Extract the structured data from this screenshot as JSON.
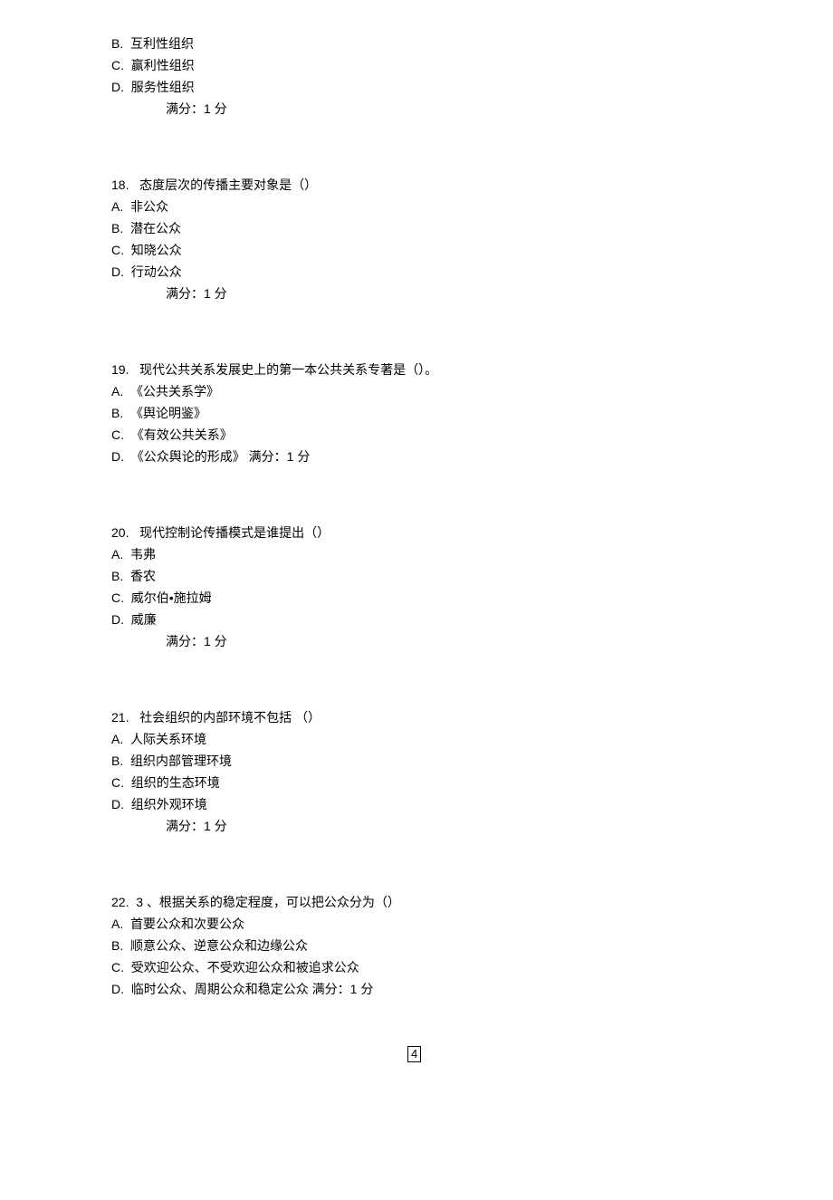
{
  "pageNumber": "4",
  "partial17": {
    "options": [
      {
        "label": "B.",
        "text": "互利性组织"
      },
      {
        "label": "C.",
        "text": "赢利性组织"
      },
      {
        "label": "D.",
        "text": "服务性组织"
      }
    ],
    "score": "满分：1 分"
  },
  "questions": [
    {
      "number": "18.",
      "stem": "态度层次的传播主要对象是（）",
      "options": [
        {
          "label": "A.",
          "text": "非公众"
        },
        {
          "label": "B.",
          "text": "潜在公众"
        },
        {
          "label": "C.",
          "text": "知晓公众"
        },
        {
          "label": "D.",
          "text": "行动公众"
        }
      ],
      "scoreInline": "",
      "score": "满分：1 分"
    },
    {
      "number": "19.",
      "stem": "现代公共关系发展史上的第一本公共关系专著是（）。",
      "options": [
        {
          "label": "A.",
          "text": "《公共关系学》"
        },
        {
          "label": "B.",
          "text": "《舆论明鉴》"
        },
        {
          "label": "C.",
          "text": "《有效公共关系》"
        },
        {
          "label": "D.",
          "text": "《公众舆论的形成》 满分：1 分"
        }
      ],
      "scoreInline": "",
      "score": ""
    },
    {
      "number": "20.",
      "stem": "现代控制论传播模式是谁提出（）",
      "options": [
        {
          "label": "A.",
          "text": "韦弗"
        },
        {
          "label": "B.",
          "text": "香农"
        },
        {
          "label": "C.",
          "text": "威尔伯•施拉姆"
        },
        {
          "label": "D.",
          "text": "威廉"
        }
      ],
      "scoreInline": "",
      "score": "满分：1 分"
    },
    {
      "number": "21.",
      "stem": "社会组织的内部环境不包括 （）",
      "options": [
        {
          "label": "A.",
          "text": "人际关系环境"
        },
        {
          "label": "B.",
          "text": "组织内部管理环境"
        },
        {
          "label": "C.",
          "text": "组织的生态环境"
        },
        {
          "label": "D.",
          "text": "组织外观环境"
        }
      ],
      "scoreInline": "",
      "score": "满分：1 分"
    },
    {
      "number": "22.",
      "stem": "3 、根据关系的稳定程度，可以把公众分为（）",
      "options": [
        {
          "label": "A.",
          "text": "首要公众和次要公众"
        },
        {
          "label": "B.",
          "text": "顺意公众、逆意公众和边缘公众"
        },
        {
          "label": "C.",
          "text": "受欢迎公众、不受欢迎公众和被追求公众"
        },
        {
          "label": "D.",
          "text": "临时公众、周期公众和稳定公众 满分：1 分"
        }
      ],
      "scoreInline": "",
      "score": ""
    }
  ]
}
